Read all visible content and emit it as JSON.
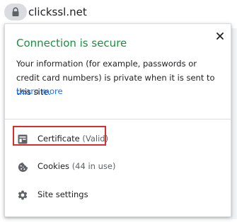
{
  "address_bar": {
    "url": "clickssl.net",
    "lock_icon": "lock-icon"
  },
  "popup": {
    "title": "Connection is secure",
    "title_color": "#1e8e3e",
    "description": "Your information (for example, passwords or credit card numbers) is private when it is sent to this site.",
    "learn_more": "Learn more",
    "link_color": "#1a73e8",
    "close_icon": "close-icon"
  },
  "menu": {
    "certificate": {
      "label": "Certificate",
      "status": "(Valid)",
      "icon": "certificate-icon"
    },
    "cookies": {
      "label": "Cookies",
      "status": "(44 in use)",
      "icon": "cookie-icon"
    },
    "site_settings": {
      "label": "Site settings",
      "icon": "gear-icon"
    }
  },
  "annotation": {
    "highlight_color": "#d32f2f"
  }
}
